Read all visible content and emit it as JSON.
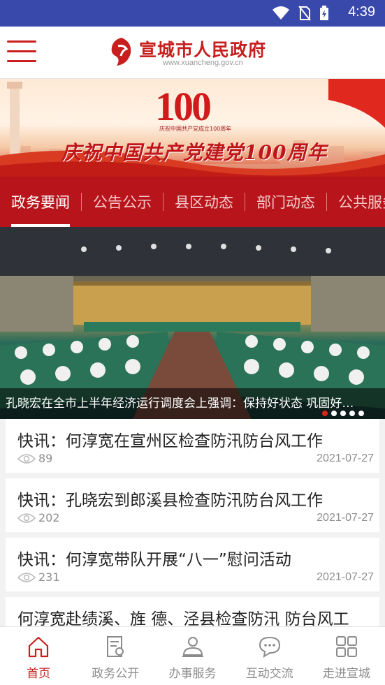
{
  "status_bar": {
    "time": "4:39"
  },
  "header": {
    "title": "宣城市人民政府",
    "subtitle": "www.xuancheng.gov.cn"
  },
  "banner": {
    "number": "100",
    "subtitle": "庆祝中国共产党成立100周年",
    "caption": "庆祝中国共产党建党100周年"
  },
  "tabs": [
    {
      "label": "政务要闻"
    },
    {
      "label": "公告公示"
    },
    {
      "label": "县区动态"
    },
    {
      "label": "部门动态"
    },
    {
      "label": "公共服务"
    }
  ],
  "hero": {
    "caption": "孔晓宏在全市上半年经济运行调度会上强调：保持好状态 巩固好…"
  },
  "news": [
    {
      "title": "快讯：何淳宽在宣州区检查防汛防台风工作",
      "views": "89",
      "date": "2021-07-27"
    },
    {
      "title": "快讯：孔晓宏到郎溪县检查防汛防台风工作",
      "views": "202",
      "date": "2021-07-27"
    },
    {
      "title": "快讯：何淳宽带队开展“八一”慰问活动",
      "views": "231",
      "date": "2021-07-27"
    },
    {
      "title": "何淳宽赴绩溪、旌 德、泾县检查防汛 防台风工",
      "views": "",
      "date": ""
    }
  ],
  "bottom_nav": [
    {
      "label": "首页",
      "icon": "home-icon"
    },
    {
      "label": "政务公开",
      "icon": "document-icon"
    },
    {
      "label": "办事服务",
      "icon": "service-icon"
    },
    {
      "label": "互动交流",
      "icon": "chat-icon"
    },
    {
      "label": "走进宣城",
      "icon": "grid-icon"
    }
  ],
  "colors": {
    "status_bar": "#3949ab",
    "brand_red": "#c81e1e",
    "tab_bar": "#b8141b"
  }
}
